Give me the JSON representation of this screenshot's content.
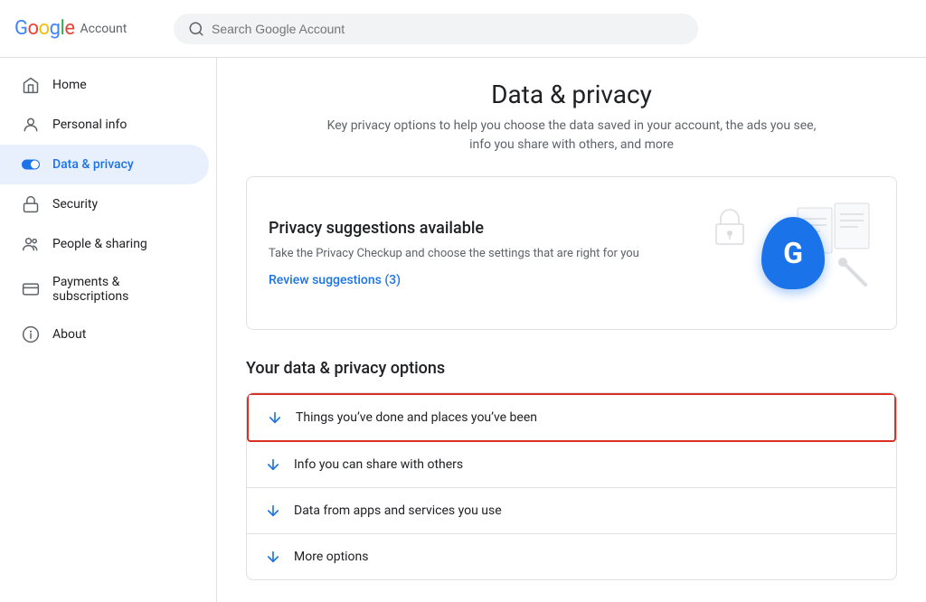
{
  "header": {
    "logo_google": "Google",
    "logo_account": "Account",
    "search_placeholder": "Search Google Account"
  },
  "sidebar": {
    "items": [
      {
        "id": "home",
        "label": "Home",
        "icon": "home"
      },
      {
        "id": "personal-info",
        "label": "Personal info",
        "icon": "person"
      },
      {
        "id": "data-privacy",
        "label": "Data & privacy",
        "icon": "toggle",
        "active": true
      },
      {
        "id": "security",
        "label": "Security",
        "icon": "lock"
      },
      {
        "id": "people-sharing",
        "label": "People & sharing",
        "icon": "people"
      },
      {
        "id": "payments",
        "label": "Payments & subscriptions",
        "icon": "card"
      },
      {
        "id": "about",
        "label": "About",
        "icon": "info"
      }
    ]
  },
  "main": {
    "page_title": "Data & privacy",
    "page_subtitle": "Key privacy options to help you choose the data saved in your account, the ads you see, info you share with others, and more",
    "privacy_card": {
      "title": "Privacy suggestions available",
      "description": "Take the Privacy Checkup and choose the settings that are right for you",
      "review_link": "Review suggestions (3)"
    },
    "options_section": {
      "title": "Your data & privacy options",
      "items": [
        {
          "label": "Things you’ve done and places you’ve been",
          "highlighted": true
        },
        {
          "label": "Info you can share with others",
          "highlighted": false
        },
        {
          "label": "Data from apps and services you use",
          "highlighted": false
        },
        {
          "label": "More options",
          "highlighted": false
        }
      ]
    }
  }
}
